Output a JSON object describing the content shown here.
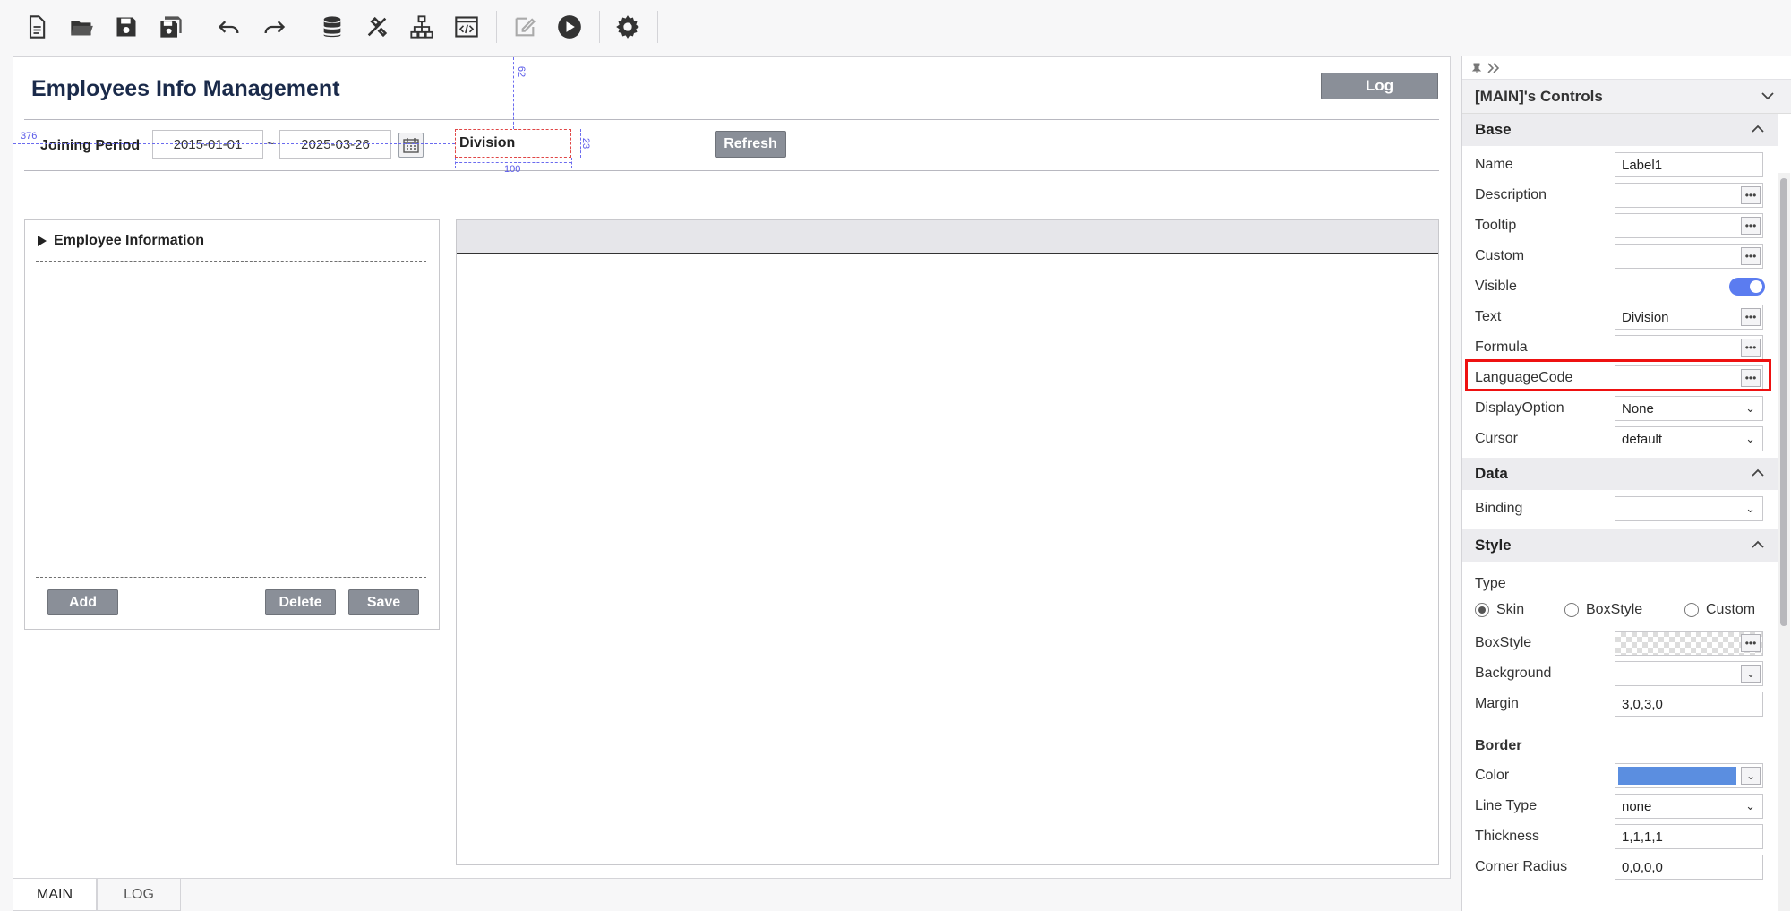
{
  "toolbar": {
    "icons": [
      "new-file-icon",
      "open-folder-icon",
      "save-icon",
      "save-all-icon",
      "undo-icon",
      "redo-icon",
      "database-icon",
      "tools-icon",
      "hierarchy-icon",
      "code-view-icon",
      "edit-icon",
      "run-icon",
      "settings-icon"
    ]
  },
  "page": {
    "title": "Employees Info Management",
    "log_button": "Log",
    "joining_label": "Joining Period",
    "date_from": "2015-01-01",
    "tilde": "~",
    "date_to": "2025-03-26",
    "division_label": "Division",
    "refresh_button": "Refresh",
    "guide_left": "376",
    "guide_top": "62",
    "guide_width": "100",
    "guide_height": "23"
  },
  "left_panel": {
    "title": "Employee Information",
    "add_button": "Add",
    "delete_button": "Delete",
    "save_button": "Save"
  },
  "tabs": [
    {
      "label": "MAIN",
      "active": true
    },
    {
      "label": "LOG",
      "active": false
    }
  ],
  "props": {
    "header": "[MAIN]'s Controls",
    "base_section": "Base",
    "name_label": "Name",
    "name_value": "Label1",
    "description_label": "Description",
    "tooltip_label": "Tooltip",
    "custom_label": "Custom",
    "visible_label": "Visible",
    "text_label": "Text",
    "text_value": "Division",
    "formula_label": "Formula",
    "languagecode_label": "LanguageCode",
    "displayoption_label": "DisplayOption",
    "displayoption_value": "None",
    "cursor_label": "Cursor",
    "cursor_value": "default",
    "data_section": "Data",
    "binding_label": "Binding",
    "style_section": "Style",
    "type_label": "Type",
    "type_skin": "Skin",
    "type_boxstyle": "BoxStyle",
    "type_custom": "Custom",
    "boxstyle_label": "BoxStyle",
    "background_label": "Background",
    "margin_label": "Margin",
    "margin_value": "3,0,3,0",
    "border_section": "Border",
    "color_label": "Color",
    "border_color": "#5b8ee0",
    "linetype_label": "Line Type",
    "linetype_value": "none",
    "thickness_label": "Thickness",
    "thickness_value": "1,1,1,1",
    "cornerradius_label": "Corner Radius",
    "cornerradius_value": "0,0,0,0"
  }
}
